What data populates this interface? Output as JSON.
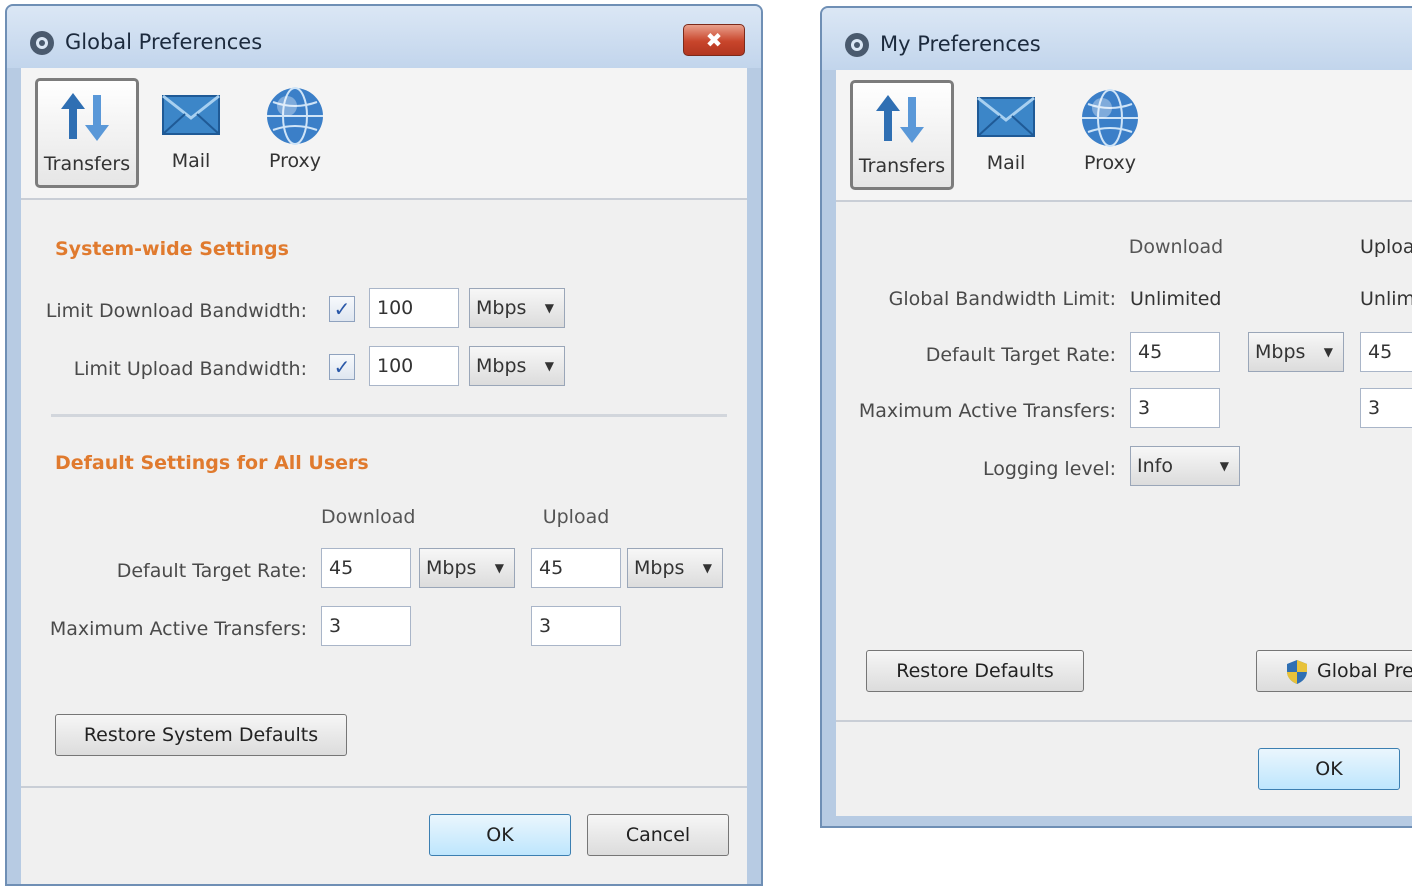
{
  "global_window": {
    "title": "Global Preferences",
    "close_label": "✖",
    "tabs": [
      {
        "label": "Transfers",
        "icon": "transfers-arrows-icon"
      },
      {
        "label": "Mail",
        "icon": "envelope-icon"
      },
      {
        "label": "Proxy",
        "icon": "globe-icon"
      }
    ],
    "selected_tab": "Transfers",
    "system_section_title": "System-wide Settings",
    "limit_download_label": "Limit Download Bandwidth:",
    "limit_download_checked": true,
    "limit_download_value": "100",
    "limit_download_unit": "Mbps",
    "limit_upload_label": "Limit Upload Bandwidth:",
    "limit_upload_checked": true,
    "limit_upload_value": "100",
    "limit_upload_unit": "Mbps",
    "defaults_section_title": "Default Settings for All Users",
    "col_download": "Download",
    "col_upload": "Upload",
    "target_rate_label": "Default Target Rate:",
    "download_rate": "45",
    "download_rate_unit": "Mbps",
    "upload_rate": "45",
    "upload_rate_unit": "Mbps",
    "max_transfers_label": "Maximum Active Transfers:",
    "download_max": "3",
    "upload_max": "3",
    "restore_button": "Restore System Defaults",
    "ok_button": "OK",
    "cancel_button": "Cancel"
  },
  "my_window": {
    "title": "My Preferences",
    "tabs": [
      {
        "label": "Transfers",
        "icon": "transfers-arrows-icon"
      },
      {
        "label": "Mail",
        "icon": "envelope-icon"
      },
      {
        "label": "Proxy",
        "icon": "globe-icon"
      }
    ],
    "selected_tab": "Transfers",
    "col_download": "Download",
    "col_upload": "Uploa",
    "global_limit_label": "Global Bandwidth Limit:",
    "global_limit_download": "Unlimited",
    "global_limit_upload": "Unlimi",
    "target_rate_label": "Default Target Rate:",
    "download_rate": "45",
    "download_rate_unit": "Mbps",
    "upload_rate": "45",
    "max_transfers_label": "Maximum Active Transfers:",
    "download_max": "3",
    "upload_max": "3",
    "logging_label": "Logging level:",
    "logging_value": "Info",
    "restore_button": "Restore Defaults",
    "global_pref_button": "Global Pre",
    "ok_button": "OK"
  },
  "colors": {
    "section_title": "#e07a2e",
    "window_frame": "#b7cbe3",
    "close_button": "#c8452b",
    "default_button": "#bee6fd"
  }
}
